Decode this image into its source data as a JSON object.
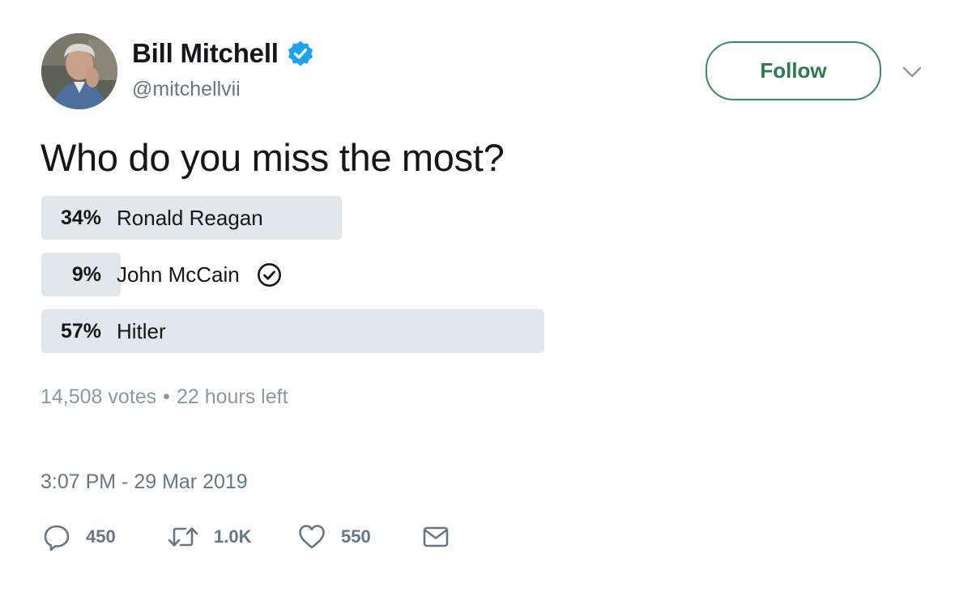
{
  "author": {
    "display_name": "Bill Mitchell",
    "handle": "@mitchellvii",
    "avatar_icon": "profile-photo",
    "verified_icon": "verified-badge-icon"
  },
  "follow_button": {
    "label": "Follow"
  },
  "menu_icon": "chevron-down-icon",
  "tweet": {
    "text": "Who do you miss the most?"
  },
  "poll": {
    "options": [
      {
        "percent_label": "34%",
        "label": "Ronald Reagan",
        "percent": 34,
        "selected": false
      },
      {
        "percent_label": "9%",
        "label": "John McCain",
        "percent": 9,
        "selected": true
      },
      {
        "percent_label": "57%",
        "label": "Hitler",
        "percent": 57,
        "selected": false
      }
    ],
    "votes": "14,508 votes",
    "separator": "•",
    "time_left": "22 hours left"
  },
  "timestamp": "3:07 PM - 29 Mar 2019",
  "actions": {
    "reply_count": "450",
    "retweet_count": "1.0K",
    "like_count": "550"
  },
  "colors": {
    "verified_blue": "#1da1f2",
    "follow_green": "#2f7a4d",
    "poll_bar": "#e1e8ed",
    "muted_text": "#657786"
  }
}
